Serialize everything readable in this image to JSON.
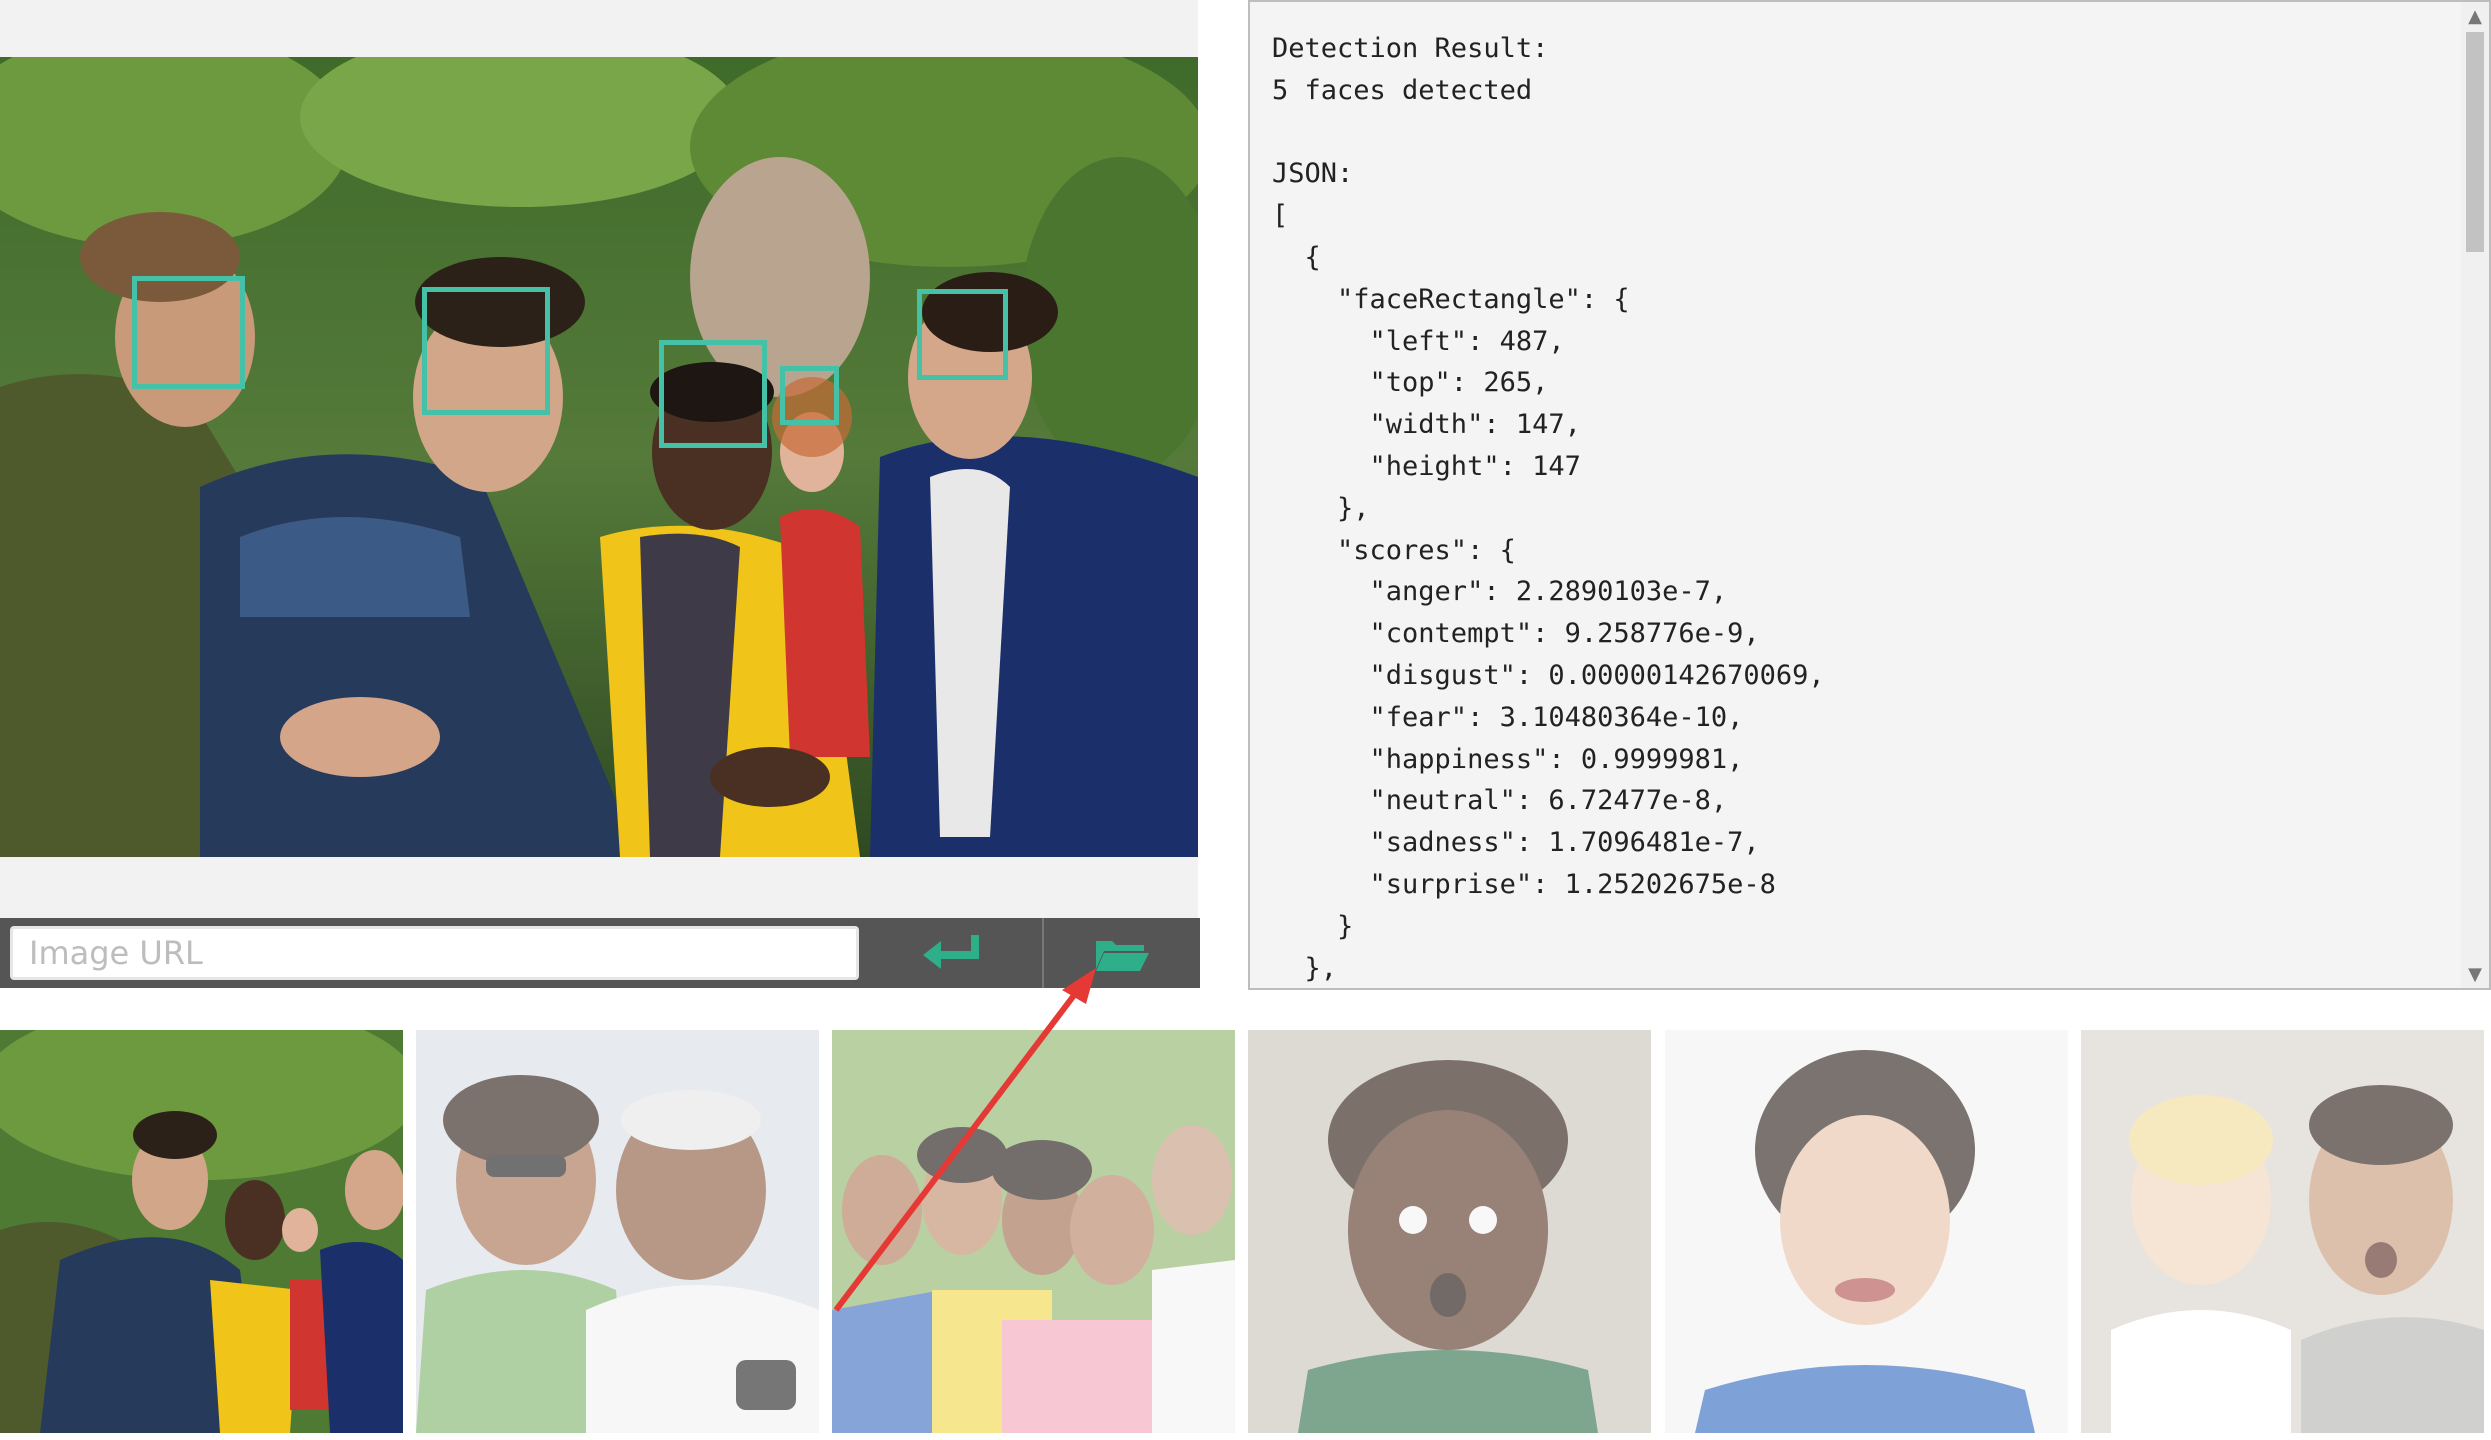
{
  "url_bar": {
    "placeholder": "Image URL",
    "submit_icon": "return-arrow-icon",
    "browse_icon": "open-folder-icon"
  },
  "result": {
    "text": "Detection Result:\n5 faces detected\n\nJSON:\n[\n  {\n    \"faceRectangle\": {\n      \"left\": 487,\n      \"top\": 265,\n      \"width\": 147,\n      \"height\": 147\n    },\n    \"scores\": {\n      \"anger\": 2.2890103e-7,\n      \"contempt\": 9.258776e-9,\n      \"disgust\": 0.00000142670069,\n      \"fear\": 3.10480364e-10,\n      \"happiness\": 0.9999981,\n      \"neutral\": 6.72477e-8,\n      \"sadness\": 1.7096481e-7,\n      \"surprise\": 1.25202675e-8\n    }\n  },"
  },
  "thumbnails": [
    {
      "subject": "group of friends outdoors",
      "selected": true
    },
    {
      "subject": "elderly couple",
      "selected": false
    },
    {
      "subject": "family group",
      "selected": false
    },
    {
      "subject": "surprised child",
      "selected": false
    },
    {
      "subject": "woman with disgusted face",
      "selected": false
    },
    {
      "subject": "toddler and man surprised",
      "selected": false
    }
  ],
  "colors": {
    "face_box": "#45c1a8",
    "accent_icon": "#2fae8a",
    "annotation_arrow": "#e53935"
  }
}
